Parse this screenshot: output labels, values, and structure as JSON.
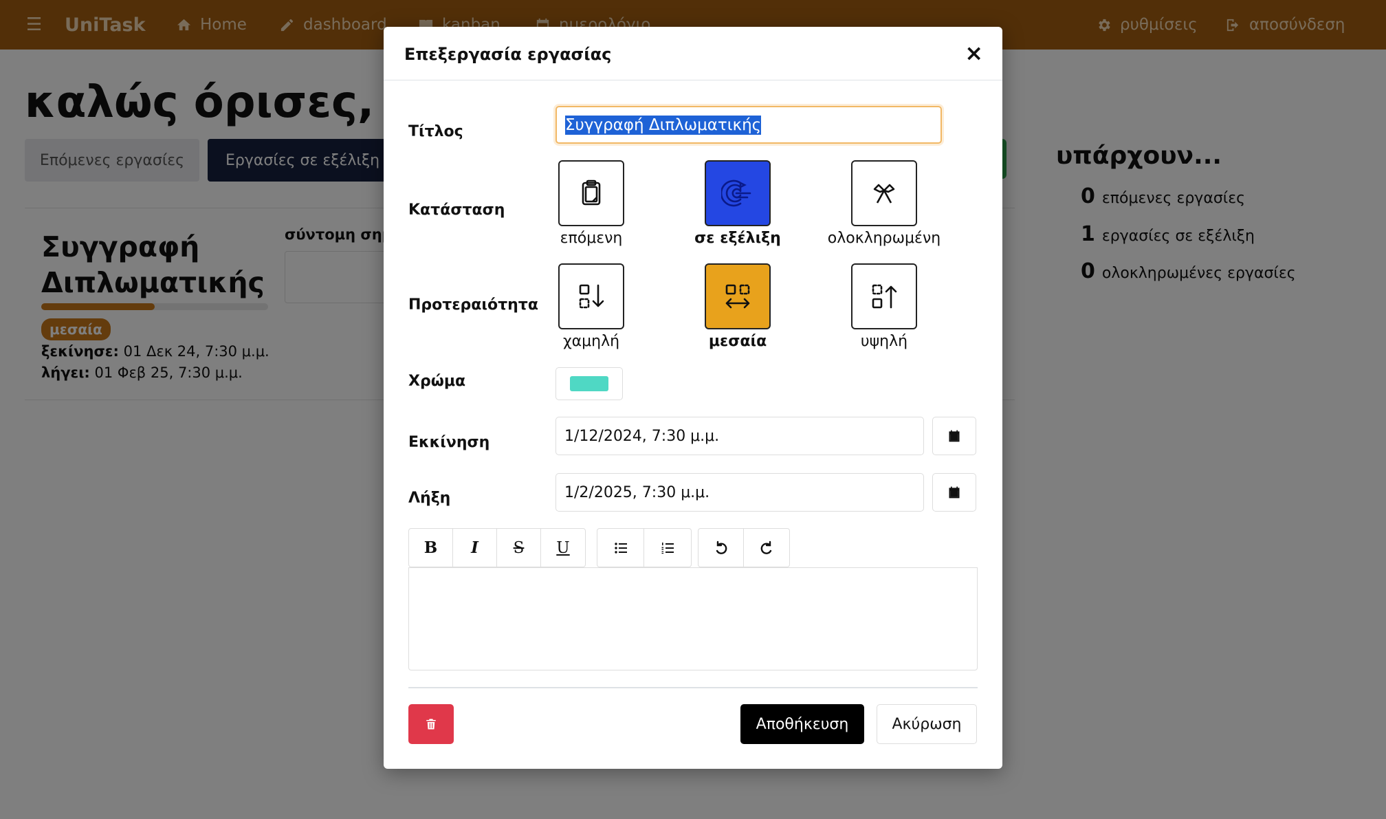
{
  "nav": {
    "brand": "UniTask",
    "menu_icon": "☰",
    "items": [
      {
        "label": "Home",
        "icon": "home-icon"
      },
      {
        "label": "dashboard",
        "icon": "pencil-icon"
      },
      {
        "label": "kanban",
        "icon": "book-icon"
      },
      {
        "label": "ημερολόγιο",
        "icon": "calendar-icon"
      },
      {
        "label": "ρυθμίσεις",
        "icon": "gear-icon"
      },
      {
        "label": "αποσύνδεση",
        "icon": "sign-out-icon"
      }
    ],
    "color": "#a45e10"
  },
  "page": {
    "welcome": "καλώς όρισες, fo",
    "tabs": [
      {
        "label": "Επόμενες εργασίες"
      },
      {
        "label": "Εργασίες σε εξέλιξη"
      }
    ],
    "card": {
      "title": "Συγγραφή Διπλωματικής",
      "progress": 0.5,
      "priority_badge": "μεσαία",
      "started_label": "ξεκίνησε:",
      "started_value": "01 Δεκ 24, 7:30 μ.μ.",
      "ends_label": "λήγει:",
      "ends_value": "01 Φεβ 25, 7:30 μ.μ.",
      "notes_label": "σύντομη σημ"
    },
    "summary": {
      "title": "υπάρχουν...",
      "lines": [
        {
          "count": "0",
          "label": "επόμενες εργασίες"
        },
        {
          "count": "1",
          "label": "εργασίες σε εξέλιξη"
        },
        {
          "count": "0",
          "label": "ολοκληρωμένες εργασίες"
        }
      ]
    }
  },
  "modal": {
    "title": "Επεξεργασία εργασίας",
    "close": "×",
    "labels": {
      "title": "Τίτλος",
      "status": "Κατάσταση",
      "priority": "Προτεραιότητα",
      "color": "Χρώμα",
      "start": "Εκκίνηση",
      "end": "Λήξη"
    },
    "title_value": "Συγγραφή Διπλωματικής",
    "status_options": [
      {
        "label": "επόμενη",
        "icon": "clipboard-icon",
        "selected": false
      },
      {
        "label": "σε εξέλιξη",
        "icon": "progress-icon",
        "selected": true
      },
      {
        "label": "ολοκληρωμένη",
        "icon": "finish-flags-icon",
        "selected": false
      }
    ],
    "priority_options": [
      {
        "label": "χαμηλή",
        "icon": "priority-low-icon",
        "selected": false
      },
      {
        "label": "μεσαία",
        "icon": "priority-medium-icon",
        "selected": true
      },
      {
        "label": "υψηλή",
        "icon": "priority-high-icon",
        "selected": false
      }
    ],
    "color_value": "#4fd8c4",
    "start_value": "1/12/2024, 7:30 μ.μ.",
    "end_value": "1/2/2025, 7:30 μ.μ.",
    "toolbar": [
      "B",
      "I",
      "S",
      "U",
      "bullet-list",
      "ordered-list",
      "undo",
      "redo"
    ],
    "save_label": "Αποθήκευση",
    "cancel_label": "Ακύρωση",
    "status_active_color": "#2447e3",
    "priority_active_color": "#e8a21c",
    "delete_color": "#e0384a"
  }
}
